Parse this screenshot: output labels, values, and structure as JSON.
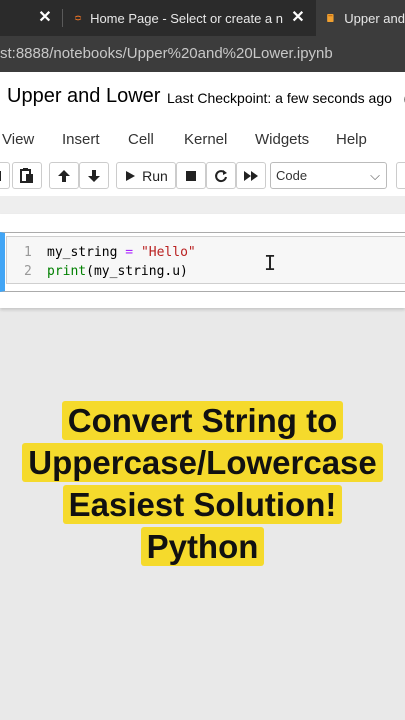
{
  "browser": {
    "tabs": [
      {
        "title": "Home Page - Select or create a n",
        "active": false
      },
      {
        "title": "Upper and",
        "active": true
      }
    ],
    "url": "st:8888/notebooks/Upper%20and%20Lower.ipynb"
  },
  "notebook": {
    "title": "Upper and Lower",
    "checkpoint": "Last Checkpoint: a few seconds ago",
    "paren": "("
  },
  "menu": [
    "View",
    "Insert",
    "Cell",
    "Kernel",
    "Widgets",
    "Help"
  ],
  "toolbar": {
    "run_label": "Run",
    "cell_type": "Code"
  },
  "cell": {
    "lines": [
      {
        "num": "1",
        "text": "my_string = \"Hello\""
      },
      {
        "num": "2",
        "text": "print(my_string.u)"
      }
    ]
  },
  "overlay": {
    "lines": [
      "Convert String to",
      "Uppercase/Lowercase",
      "Easiest Solution!",
      "Python"
    ],
    "highlight_color": "#f5da2c"
  },
  "colors": {
    "cell_selected_border": "#42a5f5",
    "keyword": "#008000",
    "string": "#ba2121"
  }
}
